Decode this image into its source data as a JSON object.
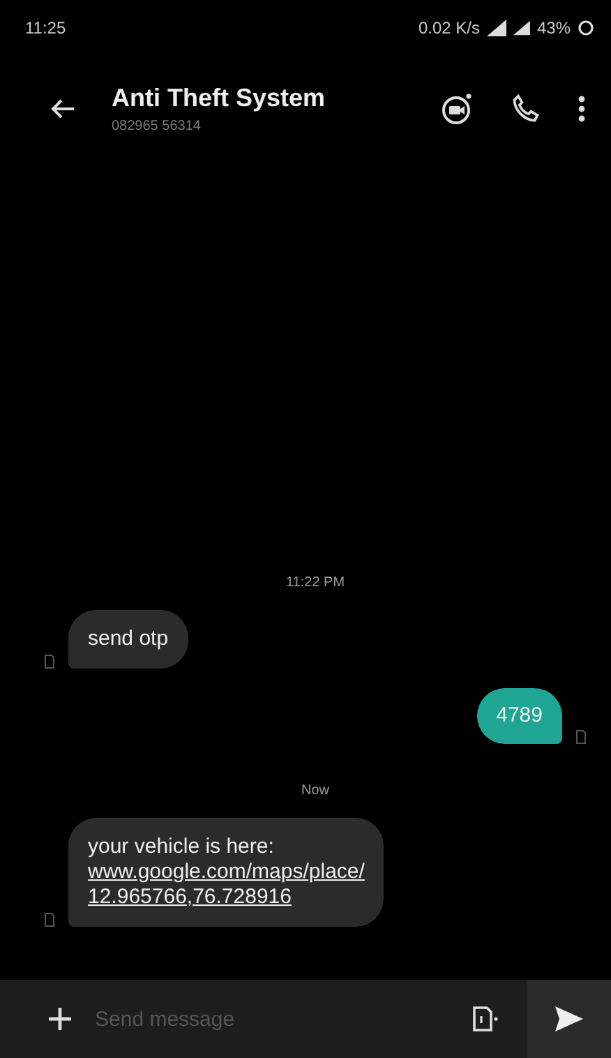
{
  "status_bar": {
    "time": "11:25",
    "network_speed": "0.02 K/s",
    "battery": "43%"
  },
  "header": {
    "title": "Anti Theft System",
    "subtitle": "082965 56314"
  },
  "messages": [
    {
      "kind": "timestamp",
      "text": "11:22 PM"
    },
    {
      "kind": "incoming",
      "text": "send otp"
    },
    {
      "kind": "outgoing",
      "text": "4789"
    },
    {
      "kind": "timestamp",
      "text": "Now"
    },
    {
      "kind": "incoming",
      "text": "your vehicle is here:",
      "link_lines": [
        "www.google.com/maps/place/",
        "12.965766,76.728916"
      ]
    }
  ],
  "composer": {
    "placeholder": "Send message"
  }
}
